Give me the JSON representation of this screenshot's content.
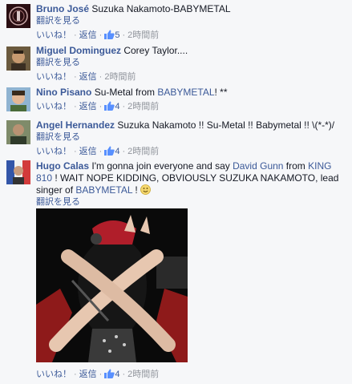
{
  "comments": [
    {
      "author": "Bruno José",
      "segments": [
        {
          "text": "Suzuka Nakamoto-BABYMETAL",
          "link": false
        }
      ],
      "translate": "翻訳を見る",
      "like": "いいね！",
      "reply": "返信",
      "likes": "5",
      "time": "2時間前"
    },
    {
      "author": "Miguel Dominguez",
      "segments": [
        {
          "text": "Corey Taylor....",
          "link": false
        }
      ],
      "translate": "翻訳を見る",
      "like": "いいね！",
      "reply": "返信",
      "likes": "",
      "time": "2時間前"
    },
    {
      "author": "Nino Pisano",
      "segments": [
        {
          "text": "Su-Metal from ",
          "link": false
        },
        {
          "text": "BABYMETAL",
          "link": true
        },
        {
          "text": "! **",
          "link": false
        }
      ],
      "translate": "",
      "like": "いいね！",
      "reply": "返信",
      "likes": "4",
      "time": "2時間前"
    },
    {
      "author": "Angel Hernandez",
      "segments": [
        {
          "text": "Suzuka Nakamoto !! Su-Metal !! Babymetal !! \\(*-*)/",
          "link": false
        }
      ],
      "translate": "翻訳を見る",
      "like": "いいね！",
      "reply": "返信",
      "likes": "4",
      "time": "2時間前"
    },
    {
      "author": "Hugo Calas",
      "segments": [
        {
          "text": "I'm gonna join everyone and say ",
          "link": false
        },
        {
          "text": "David Gunn",
          "link": true
        },
        {
          "text": " from ",
          "link": false
        },
        {
          "text": "KING 810",
          "link": true
        },
        {
          "text": " ! WAIT NOPE KIDDING, OBVIOUSLY SUZUKA NAKAMOTO, lead singer of ",
          "link": false
        },
        {
          "text": "BABYMETAL",
          "link": true
        },
        {
          "text": " ! ",
          "link": false
        }
      ],
      "emoji": "smiley",
      "translate": "翻訳を見る",
      "like": "いいね！",
      "reply": "返信",
      "likes": "4",
      "time": "2時間前"
    }
  ],
  "separator": "·",
  "like_icon": "thumbs-up-icon",
  "colors": {
    "link": "#3b5998",
    "meta": "#90949c",
    "background": "#f6f7f9"
  }
}
